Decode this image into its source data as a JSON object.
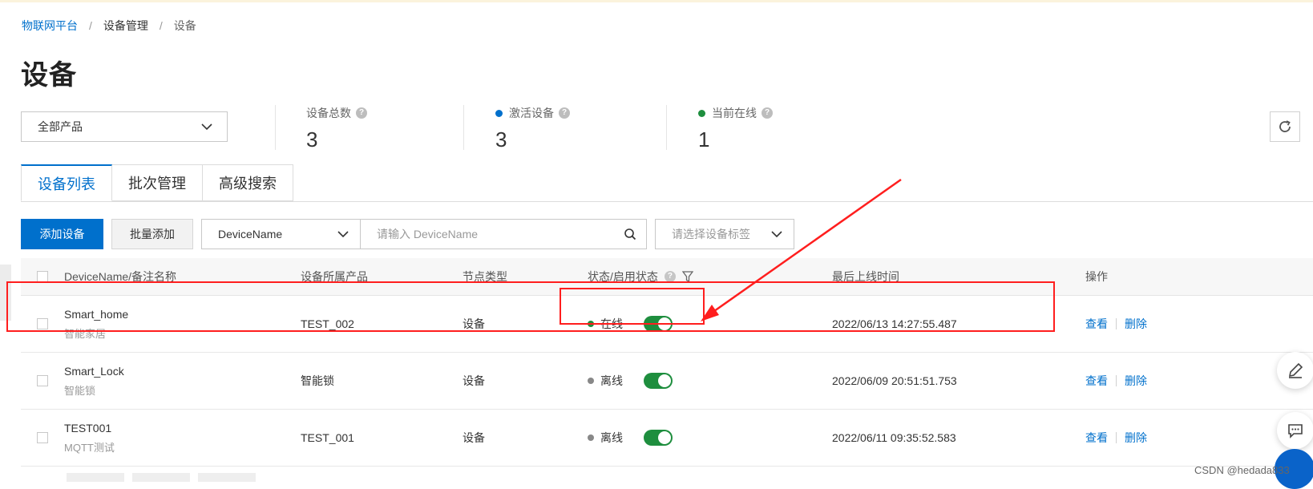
{
  "breadcrumb": {
    "items": [
      "物联网平台",
      "设备管理",
      "设备"
    ],
    "separator": "/"
  },
  "page_title": "设备",
  "product_select": {
    "value": "全部产品"
  },
  "stats": [
    {
      "label": "设备总数",
      "value": "3",
      "dot_color": ""
    },
    {
      "label": "激活设备",
      "value": "3",
      "dot_color": "#0070cc"
    },
    {
      "label": "当前在线",
      "value": "1",
      "dot_color": "#1e8e3e"
    }
  ],
  "tabs": [
    {
      "label": "设备列表",
      "active": true
    },
    {
      "label": "批次管理",
      "active": false
    },
    {
      "label": "高级搜索",
      "active": false
    }
  ],
  "toolbar": {
    "add_label": "添加设备",
    "batch_add_label": "批量添加",
    "search_field": "DeviceName",
    "search_placeholder": "请输入 DeviceName",
    "tag_placeholder": "请选择设备标签"
  },
  "table": {
    "columns": [
      "DeviceName/备注名称",
      "设备所属产品",
      "节点类型",
      "状态/启用状态",
      "最后上线时间",
      "操作"
    ],
    "rows": [
      {
        "name": "Smart_home",
        "remark": "智能家居",
        "product": "TEST_002",
        "node_type": "设备",
        "status": "在线",
        "status_color": "#1e8e3e",
        "enabled": true,
        "last_online": "2022/06/13 14:27:55.487",
        "view": "查看",
        "delete": "删除"
      },
      {
        "name": "Smart_Lock",
        "remark": "智能锁",
        "product": "智能锁",
        "node_type": "设备",
        "status": "离线",
        "status_color": "#888888",
        "enabled": true,
        "last_online": "2022/06/09 20:51:51.753",
        "view": "查看",
        "delete": "删除"
      },
      {
        "name": "TEST001",
        "remark": "MQTT测试",
        "product": "TEST_001",
        "node_type": "设备",
        "status": "离线",
        "status_color": "#888888",
        "enabled": true,
        "last_online": "2022/06/11 09:35:52.583",
        "view": "查看",
        "delete": "删除"
      }
    ]
  },
  "annotation_color": "#ff1e1e",
  "accent_color": "#0070cc",
  "watermark": "CSDN @hedada833",
  "icons": {
    "help": "?",
    "refresh": "refresh-icon",
    "search": "search-icon",
    "chevron": "chevron-down-icon",
    "filter": "filter-icon",
    "edit": "edit-icon",
    "comment": "comment-icon"
  }
}
